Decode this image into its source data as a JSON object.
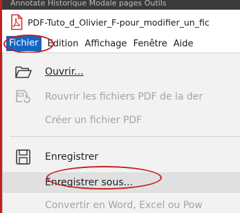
{
  "window": {
    "top_strip_text": "Annotate   Historique   Modale  pages   Outils",
    "title": "PDF-Tuto_d_Olivier_F-pour_modifier_un_fic"
  },
  "menubar": {
    "items": [
      {
        "label": "Fichier",
        "active": true
      },
      {
        "label": "Edition"
      },
      {
        "label": "Affichage"
      },
      {
        "label": "Fenêtre"
      },
      {
        "label": "Aide"
      }
    ]
  },
  "file_menu": {
    "items": [
      {
        "label": "Ouvrir...",
        "mnemonic": "O",
        "icon": "folder-open-icon",
        "enabled": true
      },
      {
        "label": "Rouvrir les fichiers PDF de la der",
        "mnemonic": "R",
        "icon": "reopen-files-icon",
        "enabled": false
      },
      {
        "label": "Créer un fichier PDF",
        "mnemonic": "C",
        "icon": "",
        "enabled": false
      },
      {
        "label": "Enregistrer",
        "mnemonic": "",
        "icon": "save-icon",
        "enabled": true
      },
      {
        "label": "Enregistrer sous...",
        "mnemonic": "n",
        "icon": "",
        "enabled": true,
        "highlighted": true
      },
      {
        "label": "Convertir en Word, Excel ou Pow",
        "mnemonic": "o",
        "icon": "",
        "enabled": false
      }
    ]
  },
  "colors": {
    "active_menu_bg": "#1565c0",
    "annotation_red": "#c41e1e",
    "pdf_icon_red": "#d32f2f",
    "menu_bg": "#f2f2f2",
    "disabled_text": "#a3a3a3"
  }
}
